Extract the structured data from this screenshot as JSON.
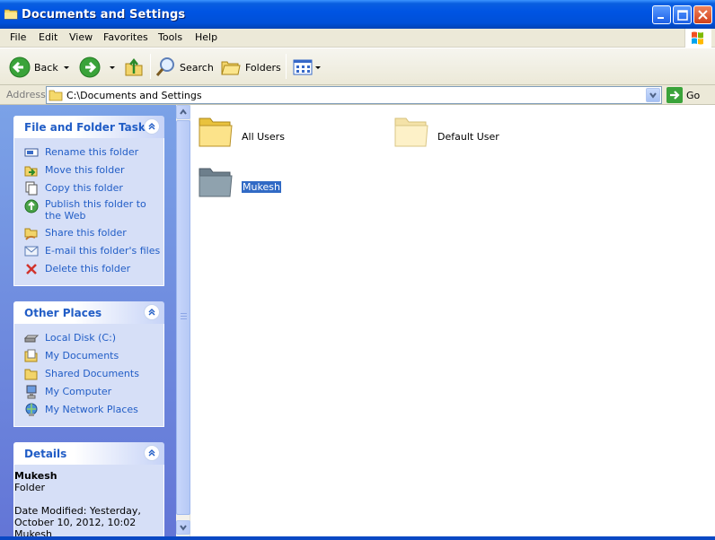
{
  "window": {
    "title": "Documents and Settings"
  },
  "menu": [
    "File",
    "Edit",
    "View",
    "Favorites",
    "Tools",
    "Help"
  ],
  "toolbar": {
    "back": "Back",
    "search": "Search",
    "folders": "Folders"
  },
  "address": {
    "label": "Address",
    "value": "C:\\Documents and Settings",
    "go": "Go"
  },
  "file_tasks": {
    "title": "File and Folder Tasks",
    "items": [
      "Rename this folder",
      "Move this folder",
      "Copy this folder",
      "Publish this folder to the Web",
      "Share this folder",
      "E-mail this folder's files",
      "Delete this folder"
    ]
  },
  "other_places": {
    "title": "Other Places",
    "items": [
      "Local Disk (C:)",
      "My Documents",
      "Shared Documents",
      "My Computer",
      "My Network Places"
    ]
  },
  "details": {
    "title": "Details",
    "name": "Mukesh",
    "type": "Folder",
    "modified": "Date Modified: Yesterday, October 10, 2012, 10:02",
    "owner": "Mukesh"
  },
  "folders": [
    {
      "name": "All Users",
      "selected": false
    },
    {
      "name": "Default User",
      "selected": false
    },
    {
      "name": "Mukesh",
      "selected": true
    }
  ],
  "colors": {
    "title_blue": "#0054e3",
    "link_blue": "#215dc6",
    "panel_blue": "#7ba2e7",
    "selection": "#316ac5"
  }
}
